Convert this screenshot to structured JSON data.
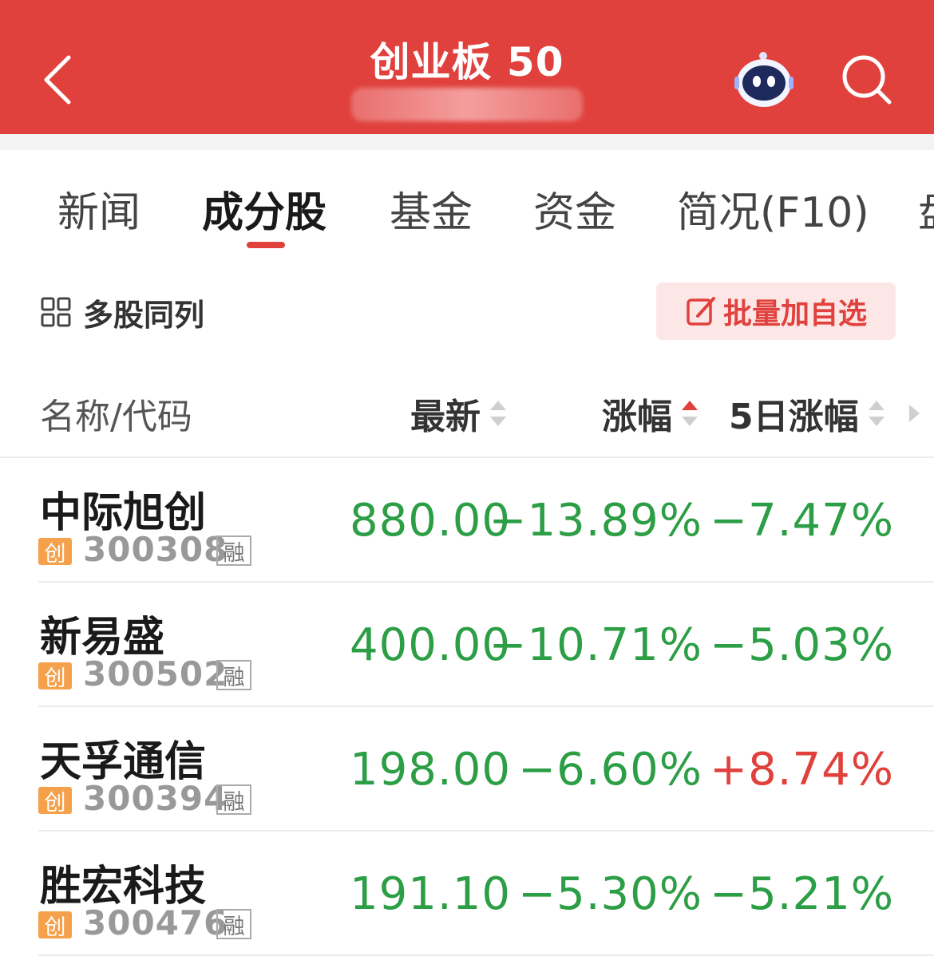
{
  "header": {
    "title": "创业板 50",
    "back_icon": "chevron-left-icon",
    "robot_icon": "robot-assistant-icon",
    "search_icon": "search-icon",
    "bg_color": "#e0413d"
  },
  "tabs": [
    {
      "label": "新闻",
      "active": false
    },
    {
      "label": "成分股",
      "active": true
    },
    {
      "label": "基金",
      "active": false
    },
    {
      "label": "资金",
      "active": false
    },
    {
      "label": "简况(F10)",
      "active": false
    },
    {
      "label": "盘",
      "active": false
    }
  ],
  "toolbar": {
    "multi_label": "多股同列",
    "batch_label": "批量加自选"
  },
  "columns": {
    "name": "名称/代码",
    "latest": "最新",
    "change": "涨幅",
    "change5": "5日涨幅",
    "active_sort": "change-desc"
  },
  "stocks": [
    {
      "name": "中际旭创",
      "badge": "创",
      "code": "300308",
      "margin": "融",
      "price": "880.00",
      "change": "−13.89%",
      "change5": "−7.47%"
    },
    {
      "name": "新易盛",
      "badge": "创",
      "code": "300502",
      "margin": "融",
      "price": "400.00",
      "change": "−10.71%",
      "change5": "−5.03%"
    },
    {
      "name": "天孚通信",
      "badge": "创",
      "code": "300394",
      "margin": "融",
      "price": "198.00",
      "change": "−6.60%",
      "change5": "+8.74%"
    },
    {
      "name": "胜宏科技",
      "badge": "创",
      "code": "300476",
      "margin": "融",
      "price": "191.10",
      "change": "−5.30%",
      "change5": "−5.21%"
    }
  ],
  "colors": {
    "down": "#2c9e45",
    "up": "#e0413d",
    "accent": "#e0413d"
  }
}
